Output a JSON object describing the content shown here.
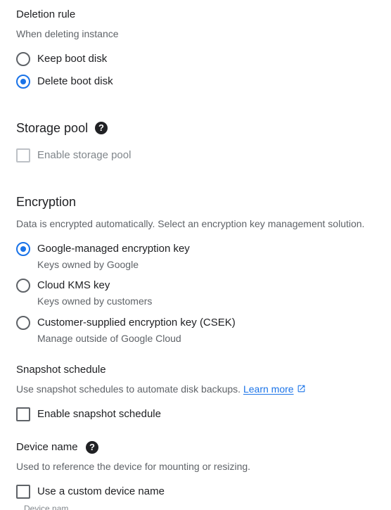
{
  "deletion_rule": {
    "title": "Deletion rule",
    "hint": "When deleting instance",
    "options": [
      {
        "label": "Keep boot disk",
        "checked": false
      },
      {
        "label": "Delete boot disk",
        "checked": true
      }
    ]
  },
  "storage_pool": {
    "title": "Storage pool",
    "help_icon": "help-icon",
    "checkbox_label": "Enable storage pool",
    "checked": false,
    "disabled": true
  },
  "encryption": {
    "title": "Encryption",
    "hint": "Data is encrypted automatically. Select an encryption key management solution.",
    "options": [
      {
        "label": "Google-managed encryption key",
        "sub": "Keys owned by Google",
        "checked": true
      },
      {
        "label": "Cloud KMS key",
        "sub": "Keys owned by customers",
        "checked": false
      },
      {
        "label": "Customer-supplied encryption key (CSEK)",
        "sub": "Manage outside of Google Cloud",
        "checked": false
      }
    ]
  },
  "snapshot_schedule": {
    "title": "Snapshot schedule",
    "hint": "Use snapshot schedules to automate disk backups.",
    "learn_more": "Learn more",
    "external_icon": "external-link-icon",
    "checkbox_label": "Enable snapshot schedule",
    "checked": false
  },
  "device_name": {
    "title": "Device name",
    "help_icon": "help-icon",
    "hint": "Used to reference the device for mounting or resizing.",
    "checkbox_label": "Use a custom device name",
    "checked": false,
    "field_label": "Device nam"
  },
  "colors": {
    "accent": "#1a73e8",
    "text": "#202124",
    "secondary": "#5f6368",
    "disabled": "#80868b"
  }
}
